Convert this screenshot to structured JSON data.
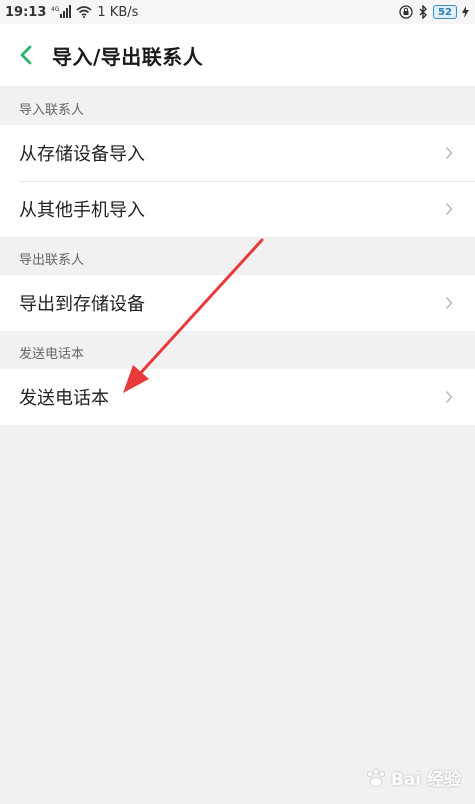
{
  "status_bar": {
    "time": "19:13",
    "network_label": "4G",
    "speed": "1 KB/s",
    "battery": "52"
  },
  "header": {
    "title": "导入/导出联系人"
  },
  "sections": [
    {
      "title": "导入联系人",
      "items": [
        "从存储设备导入",
        "从其他手机导入"
      ]
    },
    {
      "title": "导出联系人",
      "items": [
        "导出到存储设备"
      ]
    },
    {
      "title": "发送电话本",
      "items": [
        "发送电话本"
      ]
    }
  ],
  "watermark": {
    "text": "Bai 经验"
  },
  "colors": {
    "accent": "#2fb26a",
    "annotation_arrow": "#e83a3a"
  }
}
